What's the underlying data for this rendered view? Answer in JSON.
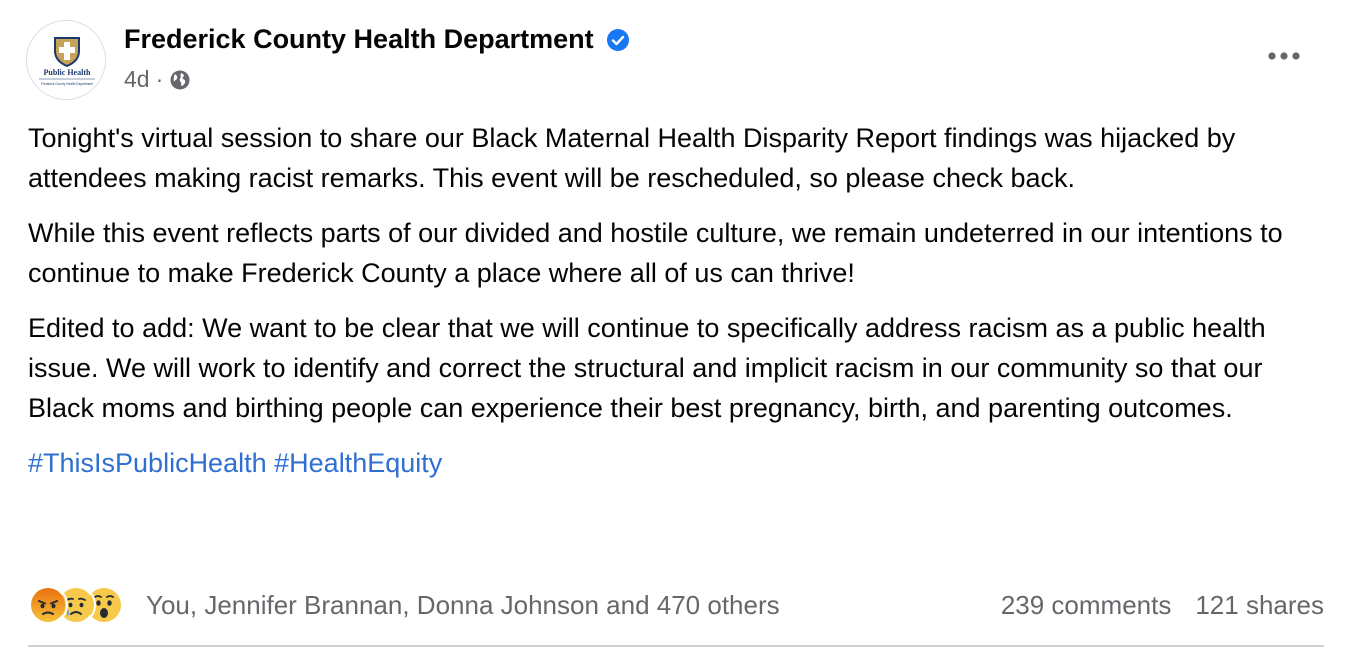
{
  "post": {
    "page_name": "Frederick County Health Department",
    "logo_text": "Public Health",
    "logo_subtext": "Frederick County Health Department",
    "time": "4d",
    "separator": "·",
    "paragraphs": [
      "Tonight's virtual session to share our Black Maternal Health Disparity Report findings was hijacked by attendees making racist remarks. This event will be rescheduled, so please check back.",
      "While this event reflects parts of our divided and hostile culture, we remain undeterred in our intentions to continue to make Frederick County a place where all of us can thrive!",
      "Edited to add: We want to be clear that we will continue to specifically address racism as a public health issue. We will work to identify and correct the structural and implicit racism in our community so that our Black moms and birthing people can experience their best pregnancy, birth, and parenting outcomes."
    ],
    "hashtags": [
      "#ThisIsPublicHealth",
      "#HealthEquity"
    ]
  },
  "footer": {
    "reaction_icons": [
      "angry-icon",
      "sad-icon",
      "wow-icon"
    ],
    "reacted_by": "You, Jennifer Brannan, Donna Johnson and 470 others",
    "comments": "239 comments",
    "shares": "121 shares"
  },
  "colors": {
    "verified": "#1877f2",
    "hashtag": "#2f6fd1",
    "secondary_text": "#65676b"
  }
}
